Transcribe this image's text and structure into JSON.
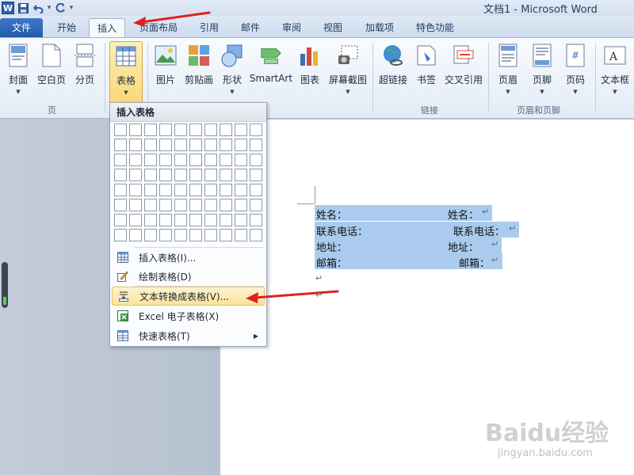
{
  "window": {
    "title": "文档1 - Microsoft Word",
    "app_logo": "W"
  },
  "quick_access": {
    "icons": [
      "word-logo-icon",
      "save-icon",
      "undo-icon",
      "dropdown-icon",
      "redo-icon",
      "customize-icon"
    ]
  },
  "tabs": [
    {
      "label": "文件",
      "kind": "file"
    },
    {
      "label": "开始"
    },
    {
      "label": "插入",
      "active": true
    },
    {
      "label": "页面布局"
    },
    {
      "label": "引用"
    },
    {
      "label": "邮件"
    },
    {
      "label": "审阅"
    },
    {
      "label": "视图"
    },
    {
      "label": "加载项"
    },
    {
      "label": "特色功能"
    }
  ],
  "ribbon": {
    "pages": {
      "cover": "封面",
      "blank": "空白页",
      "pagebreak": "分页",
      "group": "页"
    },
    "tables": {
      "table": "表格"
    },
    "illustrations": {
      "picture": "图片",
      "clipart": "剪贴画",
      "shapes": "形状",
      "smartart": "SmartArt",
      "chart": "图表",
      "screenshot": "屏幕截图"
    },
    "links": {
      "hyperlink": "超链接",
      "bookmark": "书签",
      "crossref": "交叉引用",
      "group": "链接"
    },
    "headerfooter": {
      "header": "页眉",
      "footer": "页脚",
      "pagenum": "页码",
      "group": "页眉和页脚"
    },
    "text": {
      "textbox": "文本框"
    }
  },
  "menu": {
    "header": "插入表格",
    "grid": {
      "cols": 10,
      "rows": 8
    },
    "items": [
      {
        "label": "插入表格(I)...",
        "icon": "insert-table-icon"
      },
      {
        "label": "绘制表格(D)",
        "icon": "draw-table-icon"
      },
      {
        "label": "文本转换成表格(V)...",
        "icon": "convert-text-icon",
        "highlighted": true
      },
      {
        "label": "Excel 电子表格(X)",
        "icon": "excel-icon"
      },
      {
        "label": "快速表格(T)",
        "icon": "quick-table-icon",
        "submenu": true
      }
    ]
  },
  "document": {
    "rows": [
      {
        "left": "姓名：",
        "right": "姓名："
      },
      {
        "left": "联系电话：",
        "right": "联系电话："
      },
      {
        "left": "地址：",
        "right": "地址："
      },
      {
        "left": "邮箱：",
        "right": "邮箱："
      }
    ],
    "paragraph_mark": "↵"
  },
  "watermark": {
    "brand": "Baidu经验",
    "url": "jingyan.baidu.com"
  },
  "colors": {
    "selection": "#aacbed",
    "file_tab": "#2d66b5",
    "accent_arrow": "#e02020",
    "highlight": "#fbe39a"
  }
}
